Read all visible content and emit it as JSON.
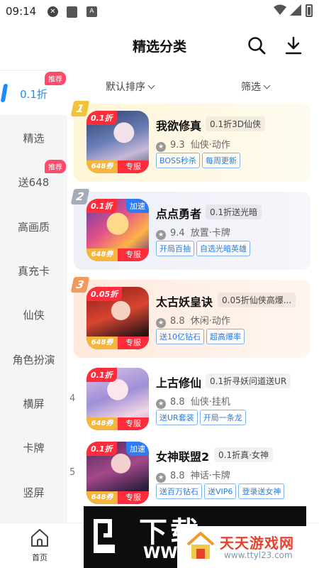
{
  "status_bar": {
    "time": "09:14",
    "a_label": "A"
  },
  "header": {
    "title": "精选分类"
  },
  "sidebar": {
    "items": [
      {
        "label": "0.1折",
        "badge": "推荐",
        "active": true
      },
      {
        "label": "精选"
      },
      {
        "label": "送648",
        "badge": "推荐"
      },
      {
        "label": "高画质"
      },
      {
        "label": "真充卡"
      },
      {
        "label": "仙侠"
      },
      {
        "label": "角色扮演"
      },
      {
        "label": "横屏"
      },
      {
        "label": "卡牌"
      },
      {
        "label": "竖屏"
      }
    ]
  },
  "sort": {
    "default_label": "默认排序",
    "filter_label": "筛选"
  },
  "games": [
    {
      "rank": "1",
      "discount": "0.1折",
      "value_tag": "648券",
      "zhuanfu": "专服",
      "name": "我欲修真",
      "subtitle": "0.1折3D仙侠",
      "score": "9.3",
      "genre": "仙侠·动作",
      "chips": [
        "BOSS秒杀",
        "每周更新"
      ]
    },
    {
      "rank": "2",
      "discount": "0.1折",
      "speed_tag": "加速",
      "value_tag": "648券",
      "zhuanfu": "专服",
      "name": "点点勇者",
      "subtitle": "0.1折送光暗",
      "score": "9.4",
      "genre": "放置·卡牌",
      "chips": [
        "开局百抽",
        "自选光暗英雄"
      ]
    },
    {
      "rank": "3",
      "discount": "0.05折",
      "value_tag": "648券",
      "zhuanfu": "专服",
      "name": "太古妖皇诀",
      "subtitle": "0.05折仙侠高爆...",
      "score": "8.8",
      "genre": "休闲·动作",
      "chips": [
        "送10亿钻石",
        "超高爆率"
      ]
    },
    {
      "rank": "4",
      "discount": "0.1折",
      "value_tag": "648券",
      "zhuanfu": "专服",
      "name": "上古修仙",
      "subtitle": "0.1折寻妖问道送UR",
      "score": "8.8",
      "genre": "仙侠·挂机",
      "chips": [
        "送UR套装",
        "开局一条龙"
      ]
    },
    {
      "rank": "5",
      "discount": "0.1折",
      "speed_tag": "加速",
      "value_tag": "648券",
      "zhuanfu": "专服",
      "name": "女神联盟2",
      "subtitle": "0.1折真·女神",
      "score": "8.8",
      "genre": "神话·卡牌",
      "chips": [
        "送百万钻石",
        "送VIP6",
        "登录送女神"
      ]
    }
  ],
  "bottom_nav": {
    "home_label": "首页"
  },
  "watermarks": {
    "left_text": "下载",
    "left_url": "WWW",
    "right_title": "天天游戏网",
    "right_url": "www.ttyl23.com"
  },
  "colors": {
    "accent": "#1a8cff",
    "discount_red": "#ff2d3c",
    "badge_pink": "#ff4a6c",
    "gold": "#f5b63b"
  }
}
